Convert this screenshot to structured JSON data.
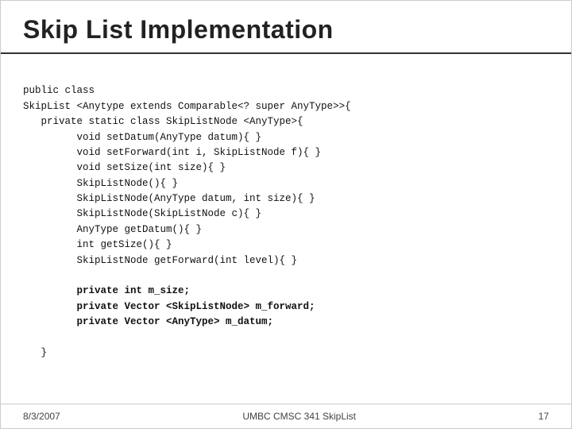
{
  "slide": {
    "title": "Skip List Implementation",
    "footer": {
      "left": "8/3/2007",
      "center": "UMBC CMSC 341 SkipList",
      "right": "17"
    },
    "code": {
      "lines": [
        {
          "text": "public class",
          "bold": false
        },
        {
          "text": "SkipList <Anytype extends Comparable<? super AnyType>>{",
          "bold": false
        },
        {
          "text": "   private static class SkipListNode <AnyType>{",
          "bold": false
        },
        {
          "text": "         void setDatum(AnyType datum){ }",
          "bold": false
        },
        {
          "text": "         void setForward(int i, SkipListNode f){ }",
          "bold": false
        },
        {
          "text": "         void setSize(int size){ }",
          "bold": false
        },
        {
          "text": "         SkipListNode(){ }",
          "bold": false
        },
        {
          "text": "         SkipListNode(AnyType datum, int size){ }",
          "bold": false
        },
        {
          "text": "         SkipListNode(SkipListNode c){ }",
          "bold": false
        },
        {
          "text": "         AnyType getDatum(){ }",
          "bold": false
        },
        {
          "text": "         int getSize(){ }",
          "bold": false
        },
        {
          "text": "         SkipListNode getForward(int level){ }",
          "bold": false
        },
        {
          "text": "",
          "bold": false
        },
        {
          "text": "         private int m_size;",
          "bold": true
        },
        {
          "text": "         private Vector <SkipListNode> m_forward;",
          "bold": true
        },
        {
          "text": "         private Vector <AnyType> m_datum;",
          "bold": true
        },
        {
          "text": "",
          "bold": false
        },
        {
          "text": "   }",
          "bold": false
        }
      ]
    }
  }
}
